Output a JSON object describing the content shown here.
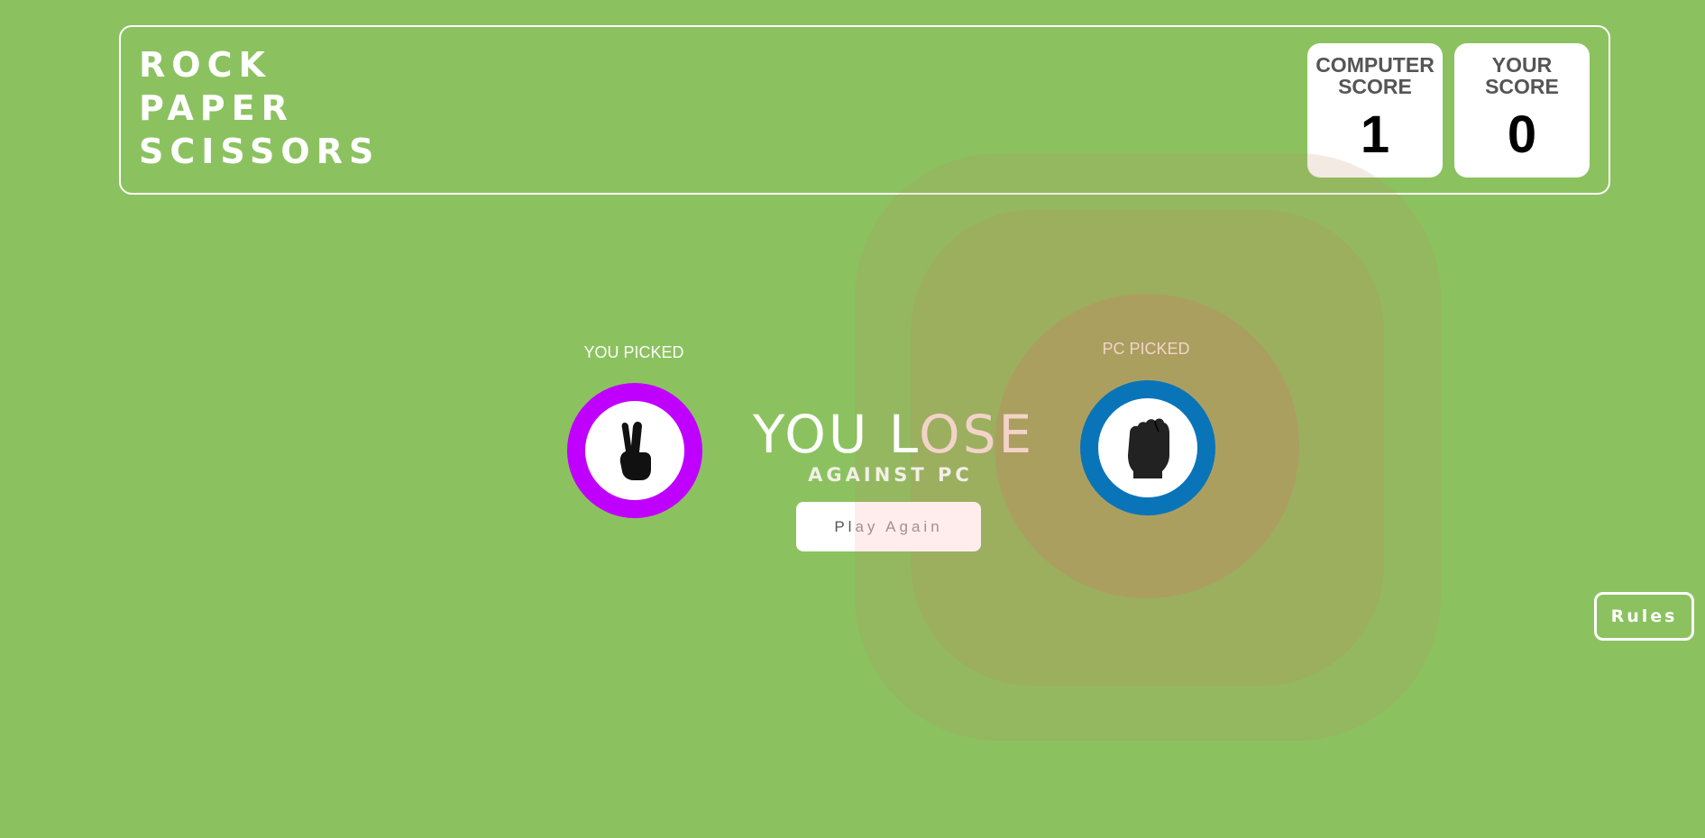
{
  "header": {
    "title_lines": [
      "ROCK",
      "PAPER",
      "SCISSORS"
    ],
    "computer_score": {
      "label_line1": "COMPUTER",
      "label_line2": "SCORE",
      "value": "1"
    },
    "your_score": {
      "label_line1": "YOUR",
      "label_line2": "SCORE",
      "value": "0"
    }
  },
  "game": {
    "you_picked_label": "YOU PICKED",
    "pc_picked_label": "PC PICKED",
    "you_choice": {
      "name": "scissors",
      "icon": "scissors-hand-icon",
      "ring_color": "#c000ff"
    },
    "pc_choice": {
      "name": "rock",
      "icon": "rock-fist-icon",
      "ring_color": "#0a74b9"
    },
    "result_part1": "YOU L",
    "result_part2": "OSE",
    "result_sub": "AGAINST PC",
    "play_again_label": "Play Again"
  },
  "rules_label": "Rules",
  "colors": {
    "background": "#8bc25f",
    "winner_glow": "#be8c64"
  }
}
